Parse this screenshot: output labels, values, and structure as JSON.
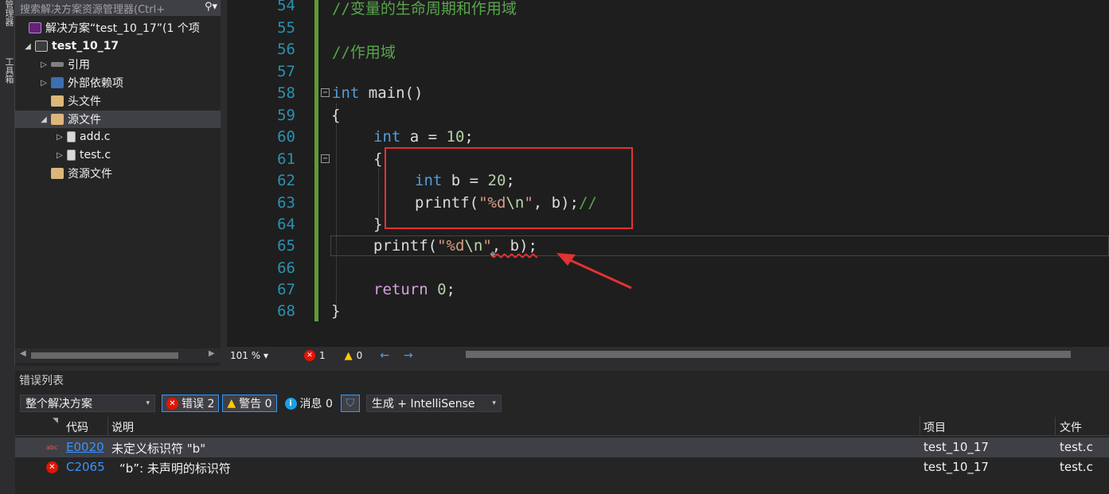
{
  "sidebar_strip": {
    "tabs": [
      "服务器资源管理器",
      "工具箱"
    ]
  },
  "solution_explorer": {
    "search_placeholder": "搜索解决方案资源管理器(Ctrl+",
    "items": [
      {
        "label": "解决方案“test_10_17”(1 个项",
        "icon": "solution-icon"
      },
      {
        "label": "test_10_17",
        "icon": "project-icon",
        "expanded": true
      },
      {
        "label": "引用",
        "icon": "references-icon"
      },
      {
        "label": "外部依赖项",
        "icon": "external-deps-icon"
      },
      {
        "label": "头文件",
        "icon": "folder-icon"
      },
      {
        "label": "源文件",
        "icon": "folder-icon",
        "expanded": true,
        "selected": true
      },
      {
        "label": "add.c",
        "icon": "c-file-icon"
      },
      {
        "label": "test.c",
        "icon": "c-file-icon"
      },
      {
        "label": "资源文件",
        "icon": "folder-icon"
      }
    ]
  },
  "editor": {
    "lines": [
      {
        "num": "54",
        "text": "//变量的生命周期和作用域"
      },
      {
        "num": "55",
        "text": ""
      },
      {
        "num": "56",
        "text": "//作用域"
      },
      {
        "num": "57",
        "text": ""
      },
      {
        "num": "58",
        "text": "int main()"
      },
      {
        "num": "59",
        "text": "{"
      },
      {
        "num": "60",
        "text": "int a = 10;"
      },
      {
        "num": "61",
        "text": "{"
      },
      {
        "num": "62",
        "text": "int b = 20;"
      },
      {
        "num": "63",
        "text": "printf(\"%d\\n\", b);//"
      },
      {
        "num": "64",
        "text": "}"
      },
      {
        "num": "65",
        "text": "printf(\"%d\\n\", b);"
      },
      {
        "num": "66",
        "text": ""
      },
      {
        "num": "67",
        "text": "return 0;"
      },
      {
        "num": "68",
        "text": "}"
      }
    ],
    "tokens": {
      "l54": "//变量的生命周期和作用域",
      "l56": "//作用域",
      "kw_int": "int",
      "main": " main()",
      "brace_open": "{",
      "brace_close": "}",
      "a_decl": " a = ",
      "b_decl": " b = ",
      "num10": "10",
      "num20": "20",
      "num0": "0",
      "semi": ";",
      "printf_open": "printf(",
      "q": "\"",
      "fmt": "%d",
      "nl": "\\n",
      "b_arg": ", b);",
      "cm_tail": "//",
      "kw_return": "return",
      "sp": " "
    }
  },
  "editor_status": {
    "zoom": "101 %",
    "error_count": "1",
    "warning_count": "0",
    "back_icon": "arrow-left-icon",
    "fwd_icon": "arrow-right-icon"
  },
  "error_list": {
    "title": "错误列表",
    "scope": "整个解决方案",
    "errors_btn": "错误 2",
    "warnings_btn": "警告 0",
    "messages_btn": "消息 0",
    "build_filter": "生成 + IntelliSense",
    "columns": {
      "code": "代码",
      "desc": "说明",
      "project": "项目",
      "file": "文件"
    },
    "rows": [
      {
        "code": "E0020",
        "desc": "未定义标识符 \"b\"",
        "project": "test_10_17",
        "file": "test.c",
        "icon": "intellisense-error-icon"
      },
      {
        "code": "C2065",
        "desc": "“b”: 未声明的标识符",
        "project": "test_10_17",
        "file": "test.c",
        "icon": "error-icon"
      }
    ]
  },
  "colors": {
    "keyword": "#569cd6",
    "comment": "#57a64a",
    "string": "#d69d85",
    "highlight_box": "#e23232",
    "arrow": "#e23232"
  }
}
